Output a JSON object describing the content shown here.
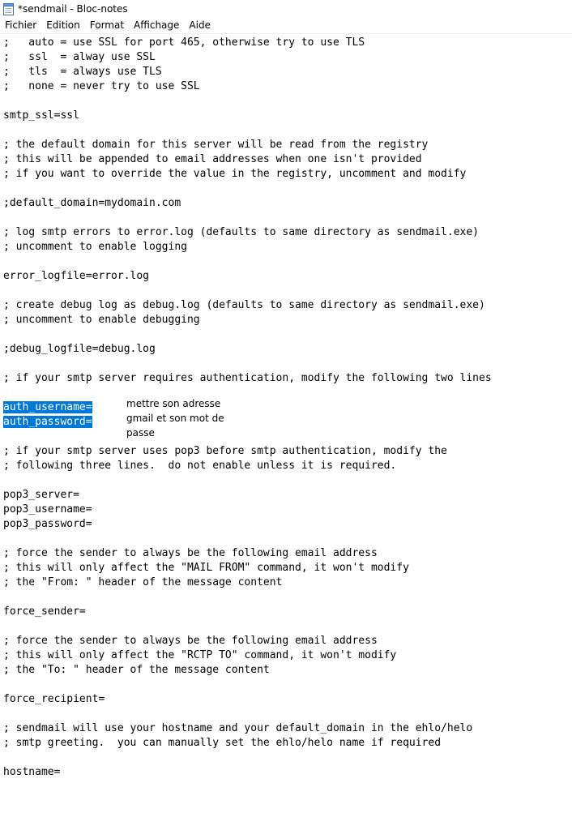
{
  "window": {
    "title": "*sendmail - Bloc-notes",
    "app_icon": "notepad-icon"
  },
  "menu": {
    "items": [
      "Fichier",
      "Edition",
      "Format",
      "Affichage",
      "Aide"
    ]
  },
  "editor": {
    "lines": [
      ";   auto = use SSL for port 465, otherwise try to use TLS",
      ";   ssl  = alway use SSL",
      ";   tls  = always use TLS",
      ";   none = never try to use SSL",
      "",
      "smtp_ssl=ssl",
      "",
      "; the default domain for this server will be read from the registry",
      "; this will be appended to email addresses when one isn't provided",
      "; if you want to override the value in the registry, uncomment and modify",
      "",
      ";default_domain=mydomain.com",
      "",
      "; log smtp errors to error.log (defaults to same directory as sendmail.exe)",
      "; uncomment to enable logging",
      "",
      "error_logfile=error.log",
      "",
      "; create debug log as debug.log (defaults to same directory as sendmail.exe)",
      "; uncomment to enable debugging",
      "",
      ";debug_logfile=debug.log",
      "",
      "; if your smtp server requires authentication, modify the following two lines",
      "",
      "auth_username=",
      "auth_password=",
      "",
      "; if your smtp server uses pop3 before smtp authentication, modify the",
      "; following three lines.  do not enable unless it is required.",
      "",
      "pop3_server=",
      "pop3_username=",
      "pop3_password=",
      "",
      "; force the sender to always be the following email address",
      "; this will only affect the \"MAIL FROM\" command, it won't modify",
      "; the \"From: \" header of the message content",
      "",
      "force_sender=",
      "",
      "; force the sender to always be the following email address",
      "; this will only affect the \"RCTP TO\" command, it won't modify",
      "; the \"To: \" header of the message content",
      "",
      "force_recipient=",
      "",
      "; sendmail will use your hostname and your default_domain in the ehlo/helo",
      "; smtp greeting.  you can manually set the ehlo/helo name if required",
      "",
      "hostname="
    ],
    "selected_lines": [
      25,
      26
    ],
    "selection_color": "#0078d7"
  },
  "annotation": {
    "lines": [
      "mettre son adresse",
      "gmail et son mot de",
      "passe"
    ]
  }
}
